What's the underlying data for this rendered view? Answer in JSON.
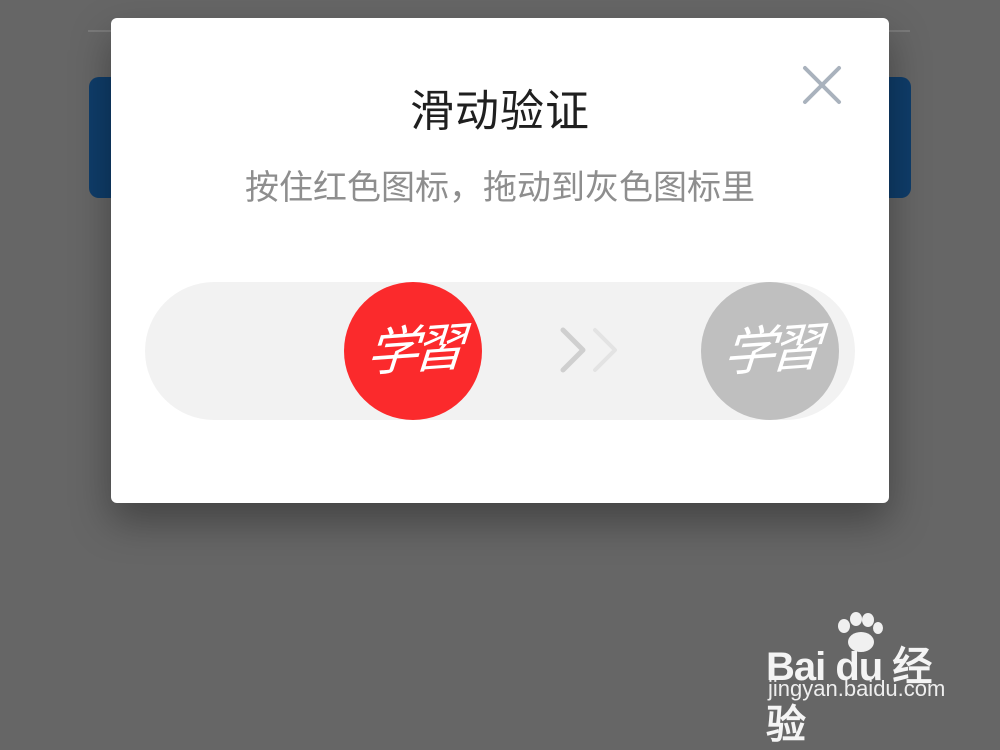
{
  "modal": {
    "title": "滑动验证",
    "subtitle": "按住红色图标，拖动到灰色图标里"
  },
  "slider": {
    "knob_text": "学習",
    "target_text": "学習",
    "knob_color": "#fb2a2c",
    "target_color": "#bfbfbf",
    "track_color": "#f2f2f2"
  },
  "icons": {
    "close": "close-icon",
    "arrows": "double-chevron-right-icon"
  },
  "watermark": {
    "brand": "Bai du 经验",
    "url": "jingyan.baidu.com"
  },
  "colors": {
    "overlay": "#666666",
    "background_button": "#0f3d6a"
  }
}
